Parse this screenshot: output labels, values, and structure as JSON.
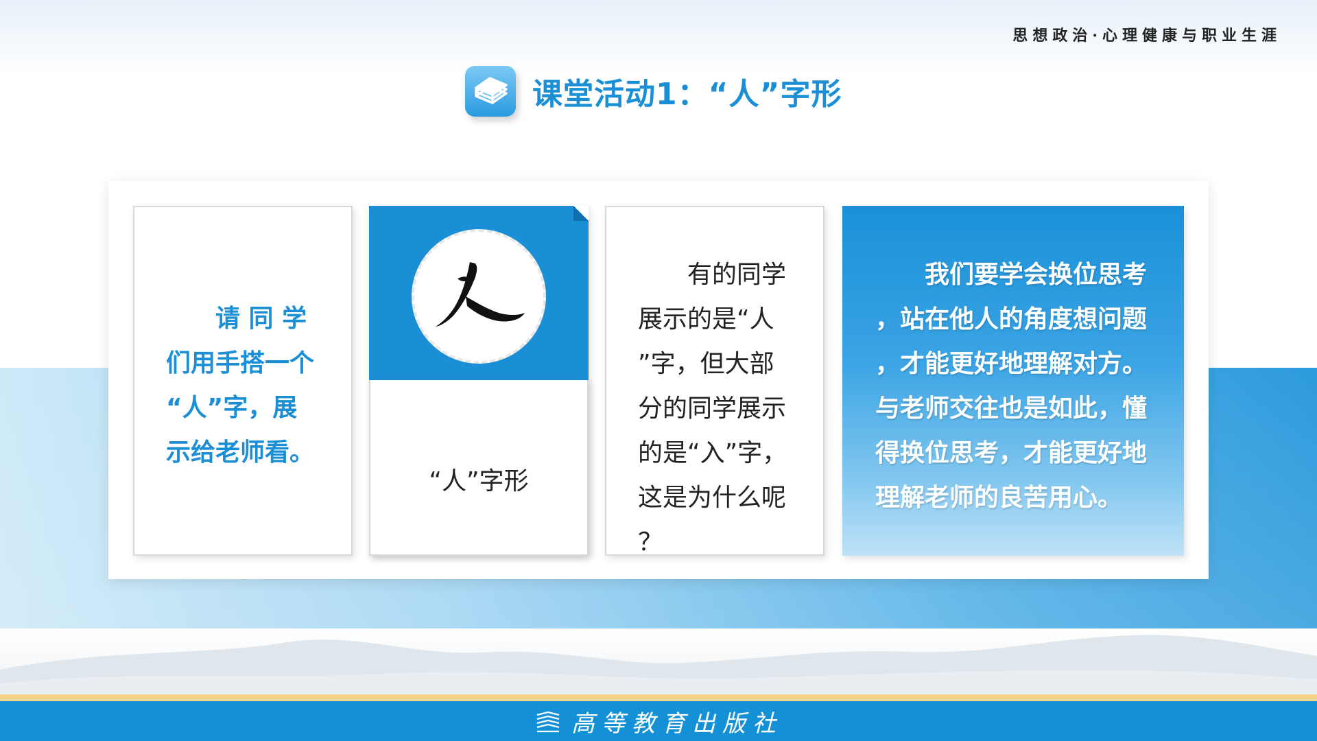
{
  "header": {
    "course_title": "思想政治·心理健康与职业生涯",
    "heading": "课堂活动1：“人”字形",
    "heading_icon": "book-stack-icon"
  },
  "cards": {
    "card1": {
      "lines": [
        "请 同 学",
        "们用手搭一个",
        "“人”字，展",
        "示给老师看。"
      ]
    },
    "card2": {
      "image_icon": "calligraphy-ren-character",
      "caption": "“人”字形"
    },
    "card3": {
      "lines": [
        "有的同学",
        "展示的是“人",
        "”字，但大部",
        "分的同学展示",
        "的是“入”字，",
        "这是为什么呢",
        "？"
      ]
    },
    "card4": {
      "lines": [
        "我们要学会换位思考",
        "，站在他人的角度想问题",
        "，才能更好地理解对方。",
        "与老师交往也是如此，懂",
        "得换位思考，才能更好地",
        "理解老师的良苦用心。"
      ]
    }
  },
  "footer": {
    "publisher": "高等教育出版社",
    "publisher_icon": "publisher-books-icon"
  },
  "colors": {
    "accent": "#1b8fd6",
    "footer_bg": "#1490d6",
    "gold_line": "#f3d58a"
  }
}
